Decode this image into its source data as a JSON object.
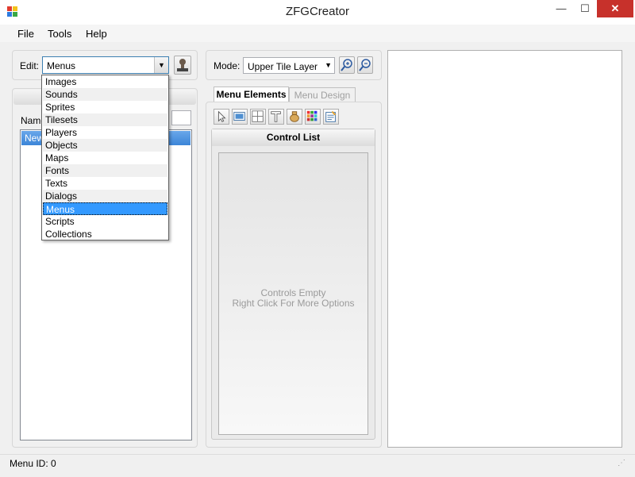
{
  "window": {
    "title": "ZFGCreator",
    "minimize": "—",
    "maximize": "☐",
    "close": "✕"
  },
  "menubar": {
    "file": "File",
    "tools": "Tools",
    "help": "Help"
  },
  "editor": {
    "edit_label": "Edit:",
    "edit_value": "Menus",
    "name_label": "Name",
    "list_item": "New"
  },
  "dropdown": {
    "options": [
      "Images",
      "Sounds",
      "Sprites",
      "Tilesets",
      "Players",
      "Objects",
      "Maps",
      "Fonts",
      "Texts",
      "Dialogs",
      "Menus",
      "Scripts",
      "Collections"
    ],
    "selected": "Menus"
  },
  "mode": {
    "label": "Mode:",
    "value": "Upper Tile Layer"
  },
  "tabs": {
    "menu_elements": "Menu Elements",
    "menu_design": "Menu Design"
  },
  "control_list": {
    "header": "Control List",
    "empty_line1": "Controls Empty",
    "empty_line2": "Right Click For More Options"
  },
  "status": {
    "menu_id": "Menu ID: 0"
  },
  "colors": {
    "selection": "#3399ff",
    "close": "#c7312b",
    "accent_border": "#3c7fb1"
  }
}
